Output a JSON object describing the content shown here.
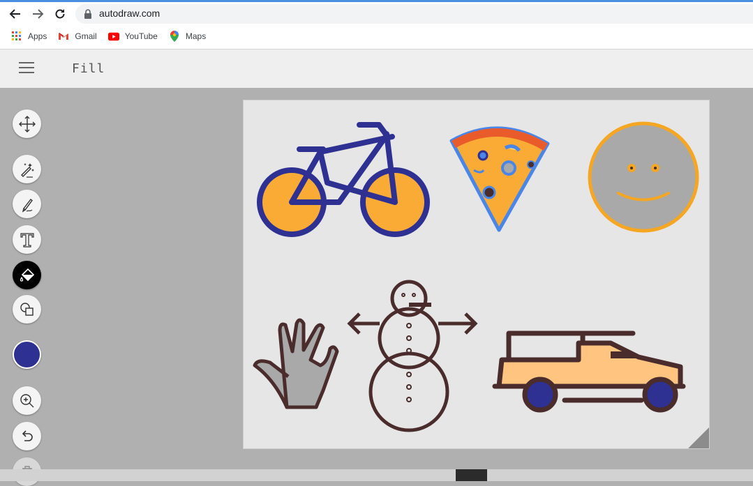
{
  "browser": {
    "url": "autodraw.com",
    "bookmarks": [
      {
        "label": "Apps",
        "icon": "apps-grid-icon"
      },
      {
        "label": "Gmail",
        "icon": "gmail-icon"
      },
      {
        "label": "YouTube",
        "icon": "youtube-icon"
      },
      {
        "label": "Maps",
        "icon": "maps-pin-icon"
      }
    ]
  },
  "app": {
    "mode_title": "Fill",
    "menu_icon": "hamburger-menu-icon"
  },
  "toolbar": {
    "tools": [
      "move-tool",
      "autodraw-tool",
      "draw-tool",
      "type-tool",
      "fill-tool",
      "shape-tool"
    ],
    "active_tool": "fill-tool",
    "current_color": "#2e3192",
    "actions": [
      "zoom-in",
      "undo",
      "delete"
    ]
  },
  "canvas": {
    "drawings": [
      "bicycle",
      "pizza-slice",
      "smiley-face",
      "hand",
      "snowman",
      "pickup-truck"
    ],
    "colors": {
      "bicycle_frame": "#2e3192",
      "bicycle_wheels": "#f9ab36",
      "pizza_crust": "#e95b2a",
      "pizza_outline": "#4a86e8",
      "smiley_fill": "#a9a9a9",
      "smiley_outline": "#f5a623",
      "hand_fill": "#a9a9a9",
      "outline_dark": "#4a2c2c",
      "truck_body": "#ffc580",
      "truck_wheels": "#2e3192"
    }
  }
}
